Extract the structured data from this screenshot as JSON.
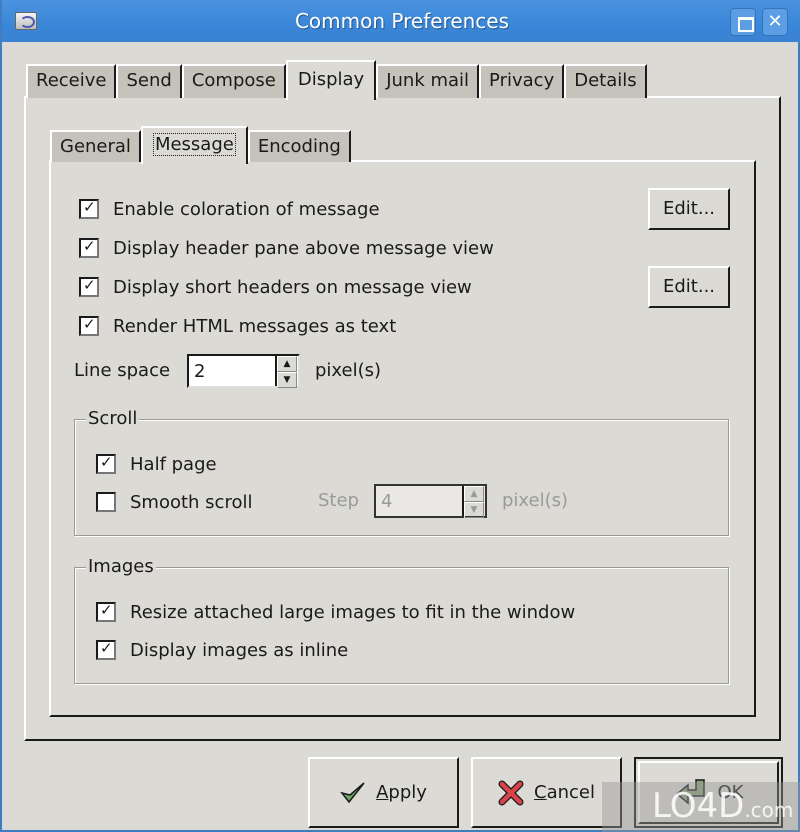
{
  "window": {
    "title": "Common Preferences",
    "app_icon": "mail-client-icon",
    "maximize_label": "",
    "close_label": "✕"
  },
  "outer_tabs": [
    {
      "label": "Receive",
      "active": false
    },
    {
      "label": "Send",
      "active": false
    },
    {
      "label": "Compose",
      "active": false
    },
    {
      "label": "Display",
      "active": true
    },
    {
      "label": "Junk mail",
      "active": false
    },
    {
      "label": "Privacy",
      "active": false
    },
    {
      "label": "Details",
      "active": false
    }
  ],
  "inner_tabs": [
    {
      "label": "General",
      "active": false
    },
    {
      "label": "Message",
      "active": true
    },
    {
      "label": "Encoding",
      "active": false
    }
  ],
  "message": {
    "options": [
      {
        "label": "Enable coloration of message",
        "checked": true
      },
      {
        "label": "Display header pane above message view",
        "checked": true
      },
      {
        "label": "Display short headers on message view",
        "checked": true
      },
      {
        "label": "Render HTML messages as text",
        "checked": true
      }
    ],
    "edit_coloration_label": "Edit...",
    "edit_headers_label": "Edit...",
    "line_space": {
      "label": "Line space",
      "value": "2",
      "unit": "pixel(s)"
    }
  },
  "scroll": {
    "title": "Scroll",
    "half_page": {
      "label": "Half page",
      "checked": true
    },
    "smooth_scroll": {
      "label": "Smooth scroll",
      "checked": false
    },
    "step": {
      "label": "Step",
      "value": "4",
      "unit": "pixel(s)",
      "disabled": true
    }
  },
  "images": {
    "title": "Images",
    "resize": {
      "label": "Resize attached large images to fit in the window",
      "checked": true
    },
    "inline": {
      "label": "Display images as inline",
      "checked": true
    }
  },
  "buttons": {
    "apply": {
      "mnemonic": "A",
      "rest": "pply"
    },
    "cancel": {
      "mnemonic": "C",
      "rest": "ancel"
    },
    "ok": {
      "label": "OK"
    }
  },
  "watermark": {
    "text": "LO4D",
    "suffix": ".com"
  }
}
